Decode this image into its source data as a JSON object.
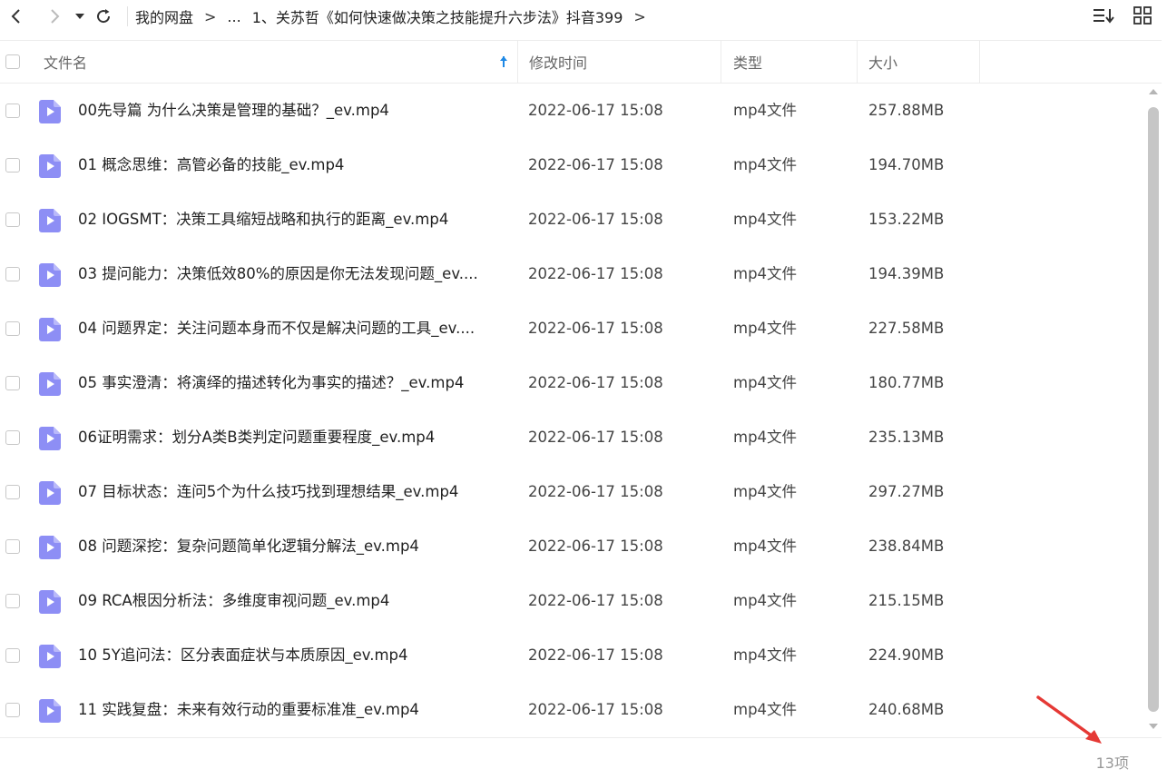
{
  "toolbar": {
    "breadcrumb": [
      "我的网盘",
      "...",
      "1、关苏哲《如何快速做决策之技能提升六步法》抖音399"
    ],
    "separator": ">"
  },
  "columns": {
    "name": "文件名",
    "modified": "修改时间",
    "type": "类型",
    "size": "大小"
  },
  "files": [
    {
      "name": "00先导篇 为什么决策是管理的基础？_ev.mp4",
      "modified": "2022-06-17 15:08",
      "type": "mp4文件",
      "size": "257.88MB"
    },
    {
      "name": "01 概念思维：高管必备的技能_ev.mp4",
      "modified": "2022-06-17 15:08",
      "type": "mp4文件",
      "size": "194.70MB"
    },
    {
      "name": "02 IOGSMT：决策工具缩短战略和执行的距离_ev.mp4",
      "modified": "2022-06-17 15:08",
      "type": "mp4文件",
      "size": "153.22MB"
    },
    {
      "name": "03 提问能力：决策低效80%的原因是你无法发现问题_ev....",
      "modified": "2022-06-17 15:08",
      "type": "mp4文件",
      "size": "194.39MB"
    },
    {
      "name": "04 问题界定：关注问题本身而不仅是解决问题的工具_ev....",
      "modified": "2022-06-17 15:08",
      "type": "mp4文件",
      "size": "227.58MB"
    },
    {
      "name": "05 事实澄清：将演绎的描述转化为事实的描述？_ev.mp4",
      "modified": "2022-06-17 15:08",
      "type": "mp4文件",
      "size": "180.77MB"
    },
    {
      "name": "06证明需求：划分A类B类判定问题重要程度_ev.mp4",
      "modified": "2022-06-17 15:08",
      "type": "mp4文件",
      "size": "235.13MB"
    },
    {
      "name": "07 目标状态：连问5个为什么技巧找到理想结果_ev.mp4",
      "modified": "2022-06-17 15:08",
      "type": "mp4文件",
      "size": "297.27MB"
    },
    {
      "name": "08 问题深挖：复杂问题简单化逻辑分解法_ev.mp4",
      "modified": "2022-06-17 15:08",
      "type": "mp4文件",
      "size": "238.84MB"
    },
    {
      "name": "09 RCA根因分析法：多维度审视问题_ev.mp4",
      "modified": "2022-06-17 15:08",
      "type": "mp4文件",
      "size": "215.15MB"
    },
    {
      "name": "10  5Y追问法：区分表面症状与本质原因_ev.mp4",
      "modified": "2022-06-17 15:08",
      "type": "mp4文件",
      "size": "224.90MB"
    },
    {
      "name": "11 实践复盘：未来有效行动的重要标准准_ev.mp4",
      "modified": "2022-06-17 15:08",
      "type": "mp4文件",
      "size": "240.68MB"
    }
  ],
  "footer": {
    "count": "13项"
  },
  "colors": {
    "file_icon": "#8d8ef5",
    "sort_arrow": "#1e88e5",
    "annotation_arrow": "#e53935"
  }
}
